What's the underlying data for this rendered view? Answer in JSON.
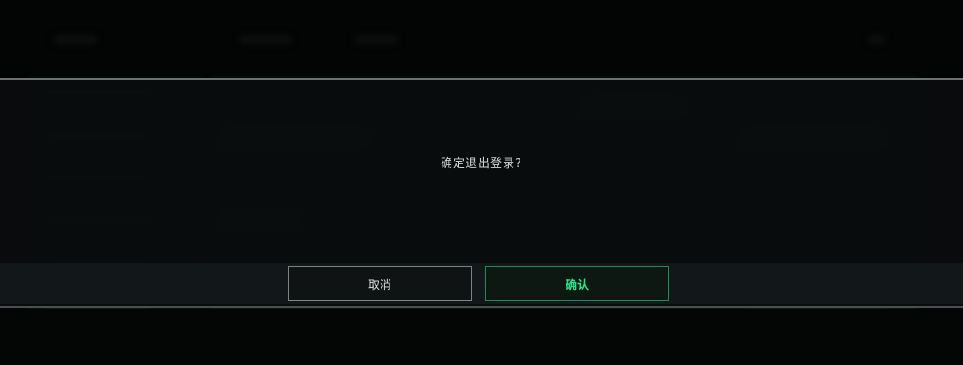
{
  "dialog": {
    "message": "确定退出登录?",
    "cancel_label": "取消",
    "confirm_label": "确认"
  },
  "colors": {
    "accent": "#22e58a",
    "confirm_border": "#1f8a57",
    "cancel_border": "#7c8486",
    "overlay": "#0a0c0d"
  }
}
